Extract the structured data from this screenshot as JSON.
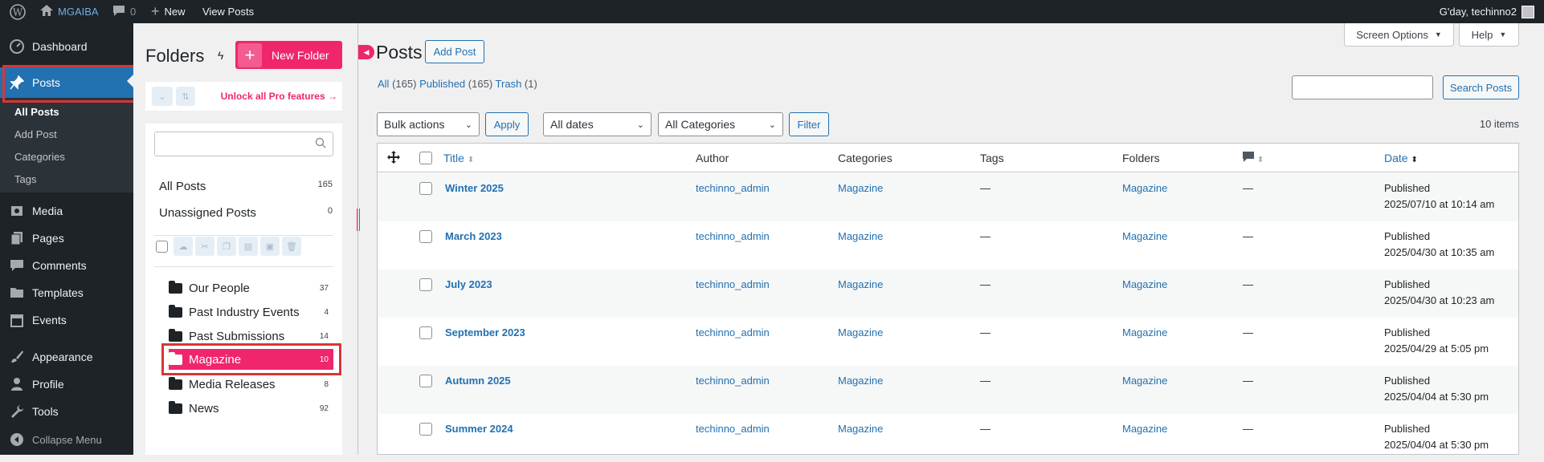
{
  "admin_bar": {
    "site_name": "MGAIBA",
    "comments_count": "0",
    "new_label": "New",
    "view_posts_label": "View Posts",
    "greeting": "G'day, techinno2"
  },
  "admin_menu": {
    "items": [
      {
        "label": "Dashboard",
        "icon": "dashboard-icon"
      },
      {
        "label": "Posts",
        "icon": "pin-icon"
      },
      {
        "label": "Media",
        "icon": "media-icon"
      },
      {
        "label": "Pages",
        "icon": "pages-icon"
      },
      {
        "label": "Comments",
        "icon": "comments-icon"
      },
      {
        "label": "Templates",
        "icon": "folder-icon"
      },
      {
        "label": "Events",
        "icon": "calendar-icon"
      },
      {
        "label": "Appearance",
        "icon": "brush-icon"
      },
      {
        "label": "Profile",
        "icon": "user-icon"
      },
      {
        "label": "Tools",
        "icon": "wrench-icon"
      },
      {
        "label": "Collapse Menu",
        "icon": "collapse-icon"
      }
    ],
    "posts_submenu": [
      "All Posts",
      "Add Post",
      "Categories",
      "Tags"
    ]
  },
  "folders_panel": {
    "title": "Folders",
    "new_folder_label": "New Folder",
    "pro_link": "Unlock all Pro features",
    "all_posts": {
      "label": "All Posts",
      "count": "165"
    },
    "unassigned": {
      "label": "Unassigned Posts",
      "count": "0"
    },
    "folders": [
      {
        "name": "Our People",
        "count": "37"
      },
      {
        "name": "Past Industry Events",
        "count": "4"
      },
      {
        "name": "Past Submissions",
        "count": "14"
      },
      {
        "name": "Magazine",
        "count": "10"
      },
      {
        "name": "Media Releases",
        "count": "8"
      },
      {
        "name": "News",
        "count": "92"
      }
    ],
    "active_folder": "Magazine"
  },
  "main": {
    "page_title": "Posts",
    "add_post_label": "Add Post",
    "screen_options": "Screen Options",
    "help": "Help",
    "views": {
      "all": "All",
      "all_count": "(165)",
      "published": "Published",
      "published_count": "(165)",
      "trash": "Trash",
      "trash_count": "(1)"
    },
    "search_button": "Search Posts",
    "bulk_actions": "Bulk actions",
    "apply": "Apply",
    "dates": "All dates",
    "categories_filter": "All Categories",
    "filter": "Filter",
    "items_count": "10 items",
    "columns": {
      "title": "Title",
      "author": "Author",
      "categories": "Categories",
      "tags": "Tags",
      "folders": "Folders",
      "date": "Date"
    },
    "rows": [
      {
        "title": "Winter 2025",
        "author": "techinno_admin",
        "category": "Magazine",
        "tags": "—",
        "folder": "Magazine",
        "comments": "—",
        "status": "Published",
        "date": "2025/07/10 at 10:14 am"
      },
      {
        "title": "March 2023",
        "author": "techinno_admin",
        "category": "Magazine",
        "tags": "—",
        "folder": "Magazine",
        "comments": "—",
        "status": "Published",
        "date": "2025/04/30 at 10:35 am"
      },
      {
        "title": "July 2023",
        "author": "techinno_admin",
        "category": "Magazine",
        "tags": "—",
        "folder": "Magazine",
        "comments": "—",
        "status": "Published",
        "date": "2025/04/30 at 10:23 am"
      },
      {
        "title": "September 2023",
        "author": "techinno_admin",
        "category": "Magazine",
        "tags": "—",
        "folder": "Magazine",
        "comments": "—",
        "status": "Published",
        "date": "2025/04/29 at 5:05 pm"
      },
      {
        "title": "Autumn 2025",
        "author": "techinno_admin",
        "category": "Magazine",
        "tags": "—",
        "folder": "Magazine",
        "comments": "—",
        "status": "Published",
        "date": "2025/04/04 at 5:30 pm"
      },
      {
        "title": "Summer 2024",
        "author": "techinno_admin",
        "category": "Magazine",
        "tags": "—",
        "folder": "Magazine",
        "comments": "—",
        "status": "Published",
        "date": "2025/04/04 at 5:30 pm"
      }
    ]
  },
  "colors": {
    "accent": "#2271b1",
    "pink": "#f0266c",
    "highlight_box": "#d63638",
    "admin_bg": "#1d2327"
  }
}
